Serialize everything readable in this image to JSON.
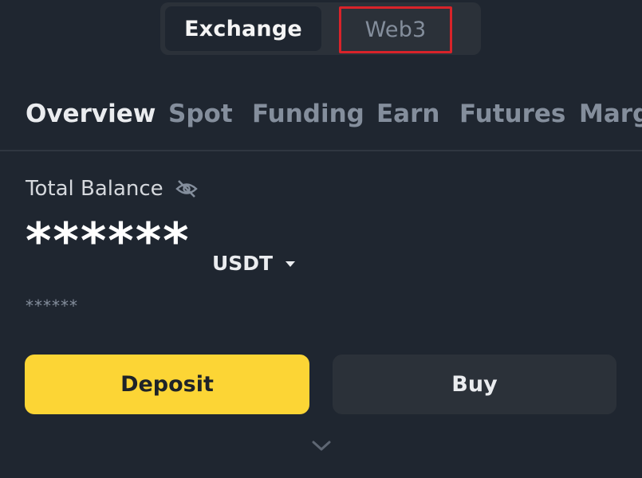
{
  "switch": {
    "exchange_label": "Exchange",
    "web3_label": "Web3"
  },
  "tabs": [
    {
      "label": "Overview",
      "active": true
    },
    {
      "label": "Spot"
    },
    {
      "label": "Funding"
    },
    {
      "label": "Earn"
    },
    {
      "label": "Futures"
    },
    {
      "label": "Marg"
    }
  ],
  "balance": {
    "label": "Total Balance",
    "value": "******",
    "currency": "USDT",
    "secondary": "******"
  },
  "actions": {
    "deposit_label": "Deposit",
    "buy_label": "Buy"
  },
  "colors": {
    "background": "#1f2630",
    "accent": "#fcd535",
    "muted_text": "#848e9c",
    "highlight_box": "#d8232a"
  },
  "icons": {
    "visibility": "eye-off-icon",
    "currency_dropdown": "caret-down-icon",
    "expand": "chevron-down-icon"
  }
}
